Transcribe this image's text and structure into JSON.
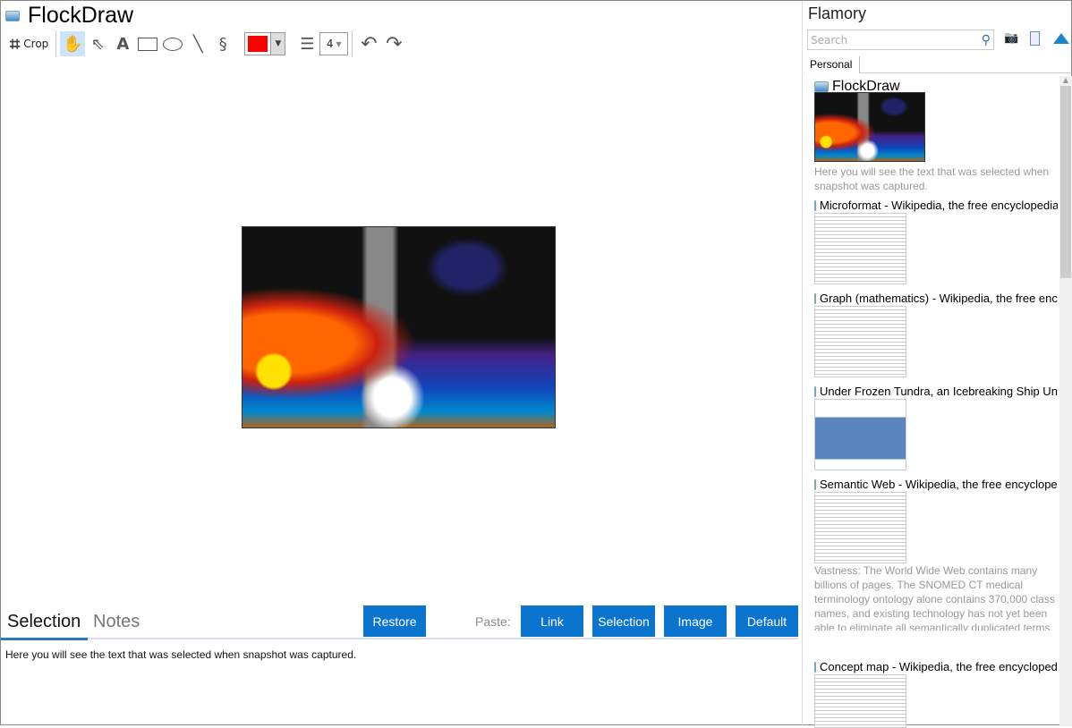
{
  "app": {
    "title": "FlockDraw"
  },
  "toolbar": {
    "crop_label": "Crop",
    "line_width": "4",
    "color": "#ff0000"
  },
  "bottom": {
    "tabs": [
      {
        "label": "Selection"
      },
      {
        "label": "Notes"
      }
    ],
    "restore": "Restore",
    "paste_label": "Paste:",
    "paste_buttons": [
      "Link",
      "Selection",
      "Image",
      "Default"
    ],
    "selection_text": "Here you will see the text that was selected when snapshot was captured."
  },
  "panel": {
    "title": "Flamory",
    "search_placeholder": "Search",
    "tab": "Personal",
    "items": [
      {
        "title": "FlockDraw",
        "desc": "Here you will see the text that was selected when snapshot was captured."
      },
      {
        "title": "Microformat - Wikipedia, the free encyclopedia"
      },
      {
        "title": "Graph (mathematics) - Wikipedia, the free encyclopedia"
      },
      {
        "title": "Under Frozen Tundra, an Icebreaking Ship Uncovers"
      },
      {
        "title": "Semantic Web - Wikipedia, the free encyclopedia",
        "desc": "Vastness: The World Wide Web contains many billions of pages. The SNOMED CT medical terminology ontology alone contains 370,000 class names, and existing technology has not yet been able to eliminate all semantically duplicated terms. Any automated reasoning system will have to deal with truly huge inputs."
      },
      {
        "title": "Concept map - Wikipedia, the free encyclopedia"
      }
    ]
  },
  "colors": {
    "accent": "#0a74cf"
  }
}
